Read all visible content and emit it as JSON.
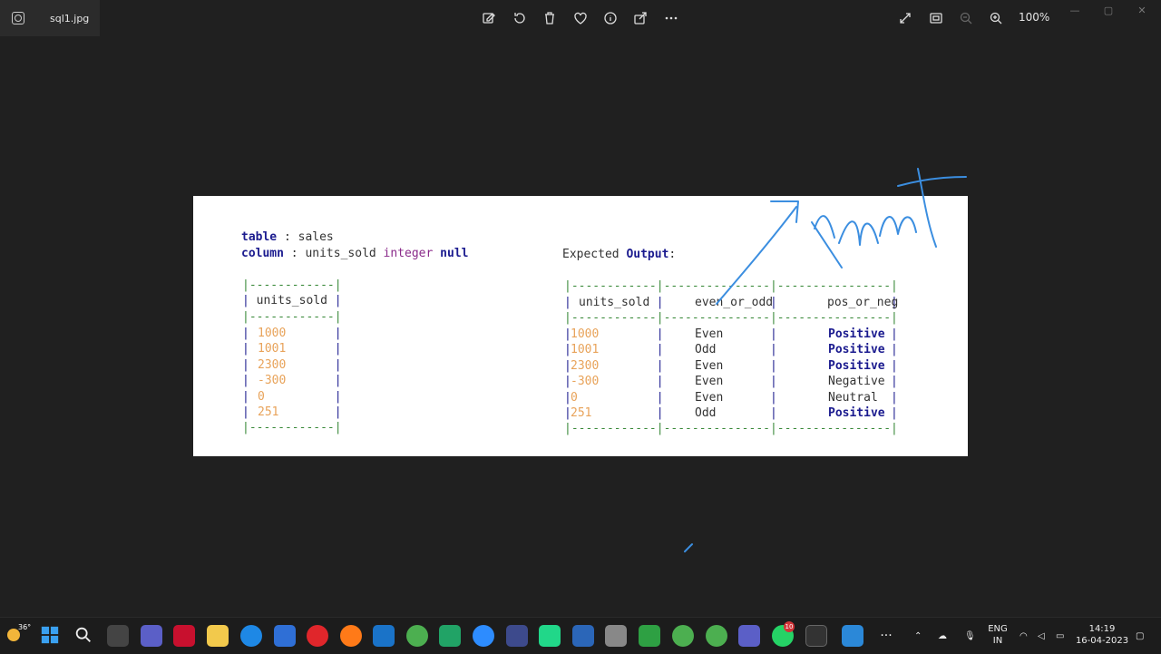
{
  "window": {
    "file_name": "sql1.jpg",
    "zoom": "100%"
  },
  "toolbar": {
    "icons": [
      "edit-image-icon",
      "rotate-icon",
      "delete-icon",
      "favorite-icon",
      "info-icon",
      "share-icon",
      "more-icon"
    ],
    "right_icons": [
      "fullscreen-icon",
      "fit-window-icon",
      "zoom-out-icon",
      "zoom-in-icon"
    ]
  },
  "image": {
    "table_kw": "table",
    "table_sep": " : ",
    "table_name": "sales",
    "column_kw": "column",
    "column_sep": " : ",
    "column_name": "units_sold ",
    "column_type": "integer",
    "column_null": "null",
    "expected_label": "Expected ",
    "expected_output": "Output",
    "expected_colon": ":",
    "left_table": {
      "header": "units_sold",
      "values": [
        "1000",
        "1001",
        "2300",
        "-300",
        "0",
        "251"
      ]
    },
    "right_table": {
      "headers": [
        "units_sold",
        "even_or_odd",
        "pos_or_neg"
      ],
      "rows": [
        {
          "units": "1000",
          "parity": "Even",
          "sign": "Positive"
        },
        {
          "units": "1001",
          "parity": "Odd",
          "sign": "Positive"
        },
        {
          "units": "2300",
          "parity": "Even",
          "sign": "Positive"
        },
        {
          "units": "-300",
          "parity": "Even",
          "sign": "Negative"
        },
        {
          "units": "0",
          "parity": "Even",
          "sign": "Neutral"
        },
        {
          "units": "251",
          "parity": "Odd",
          "sign": "Positive"
        }
      ]
    }
  },
  "taskbar": {
    "weather": "36°",
    "lang_line1": "ENG",
    "lang_line2": "IN",
    "time": "14:19",
    "date": "16-04-2023",
    "teams_badge": "",
    "whatsapp_badge": "10",
    "colors": {
      "accent": "#0078d4"
    }
  }
}
